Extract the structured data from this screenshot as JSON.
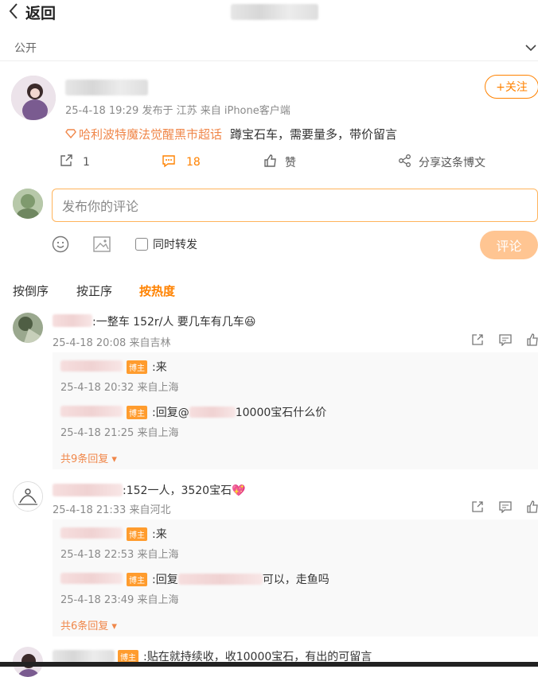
{
  "header": {
    "back_label": "返回",
    "visibility": "公开"
  },
  "post": {
    "follow_label": "+关注",
    "meta": "25-4-18 19:29  发布于 江苏  来自 iPhone客户端",
    "topic": "哈利波特魔法觉醒黑市超话",
    "text": "蹲宝石车，需要量多，带价留言",
    "share_count": "1",
    "comment_count": "18",
    "like_label": "赞",
    "share_weibo_label": "分享这条博文"
  },
  "composer": {
    "placeholder": "发布你的评论",
    "repost_label": "同时转发",
    "submit_label": "评论"
  },
  "sort": {
    "tabs": [
      "按倒序",
      "按正序",
      "按热度"
    ],
    "active": "按热度"
  },
  "comments": [
    {
      "text": ":一整车 152r/人  要几车有几车",
      "emoji": "😆",
      "meta": "25-4-18 20:08  来自吉林",
      "replies": [
        {
          "tag": "博主",
          "text": ":来",
          "meta": "25-4-18 20:32  来自上海"
        },
        {
          "tag": "博主",
          "text_prefix": ":回复@",
          "text_suffix": "10000宝石什么价",
          "meta": "25-4-18 21:25  来自上海"
        }
      ],
      "more": "共9条回复"
    },
    {
      "text": ":152一人，3520宝石",
      "emoji": "💖",
      "meta": "25-4-18 21:33  来自河北",
      "replies": [
        {
          "tag": "博主",
          "text": ":来",
          "meta": "25-4-18 22:53  来自上海"
        },
        {
          "tag": "博主",
          "text_prefix": ":回复",
          "text_suffix": "可以，走鱼吗",
          "meta": "25-4-18 23:49  来自上海"
        }
      ],
      "more": "共6条回复"
    },
    {
      "tag": "博主",
      "text": ":贴在就持续收，收10000宝石，有出的可留言"
    }
  ],
  "colors": {
    "accent": "#ff8200",
    "topic": "#f0874a",
    "button_disabled": "#ffc592"
  }
}
